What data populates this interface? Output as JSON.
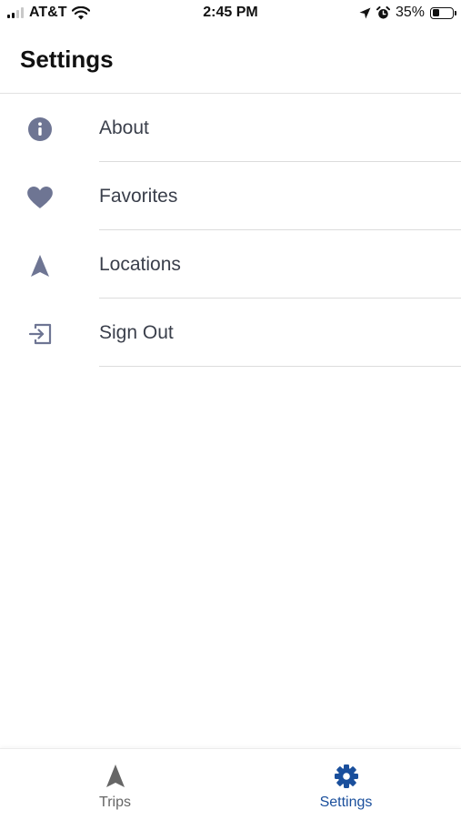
{
  "status_bar": {
    "carrier": "AT&T",
    "time": "2:45 PM",
    "battery_percent": "35%",
    "battery_level": 0.35,
    "icons": [
      "signal-icon",
      "wifi-icon",
      "location-arrow-icon",
      "alarm-icon",
      "battery-icon"
    ]
  },
  "header": {
    "title": "Settings"
  },
  "menu": {
    "items": [
      {
        "label": "About",
        "icon": "info-icon"
      },
      {
        "label": "Favorites",
        "icon": "heart-icon"
      },
      {
        "label": "Locations",
        "icon": "navigation-arrow-icon"
      },
      {
        "label": "Sign Out",
        "icon": "sign-out-icon"
      }
    ]
  },
  "tab_bar": {
    "tabs": [
      {
        "label": "Trips",
        "icon": "navigation-arrow-icon",
        "active": false
      },
      {
        "label": "Settings",
        "icon": "gear-icon",
        "active": true
      }
    ]
  },
  "colors": {
    "menu_icon": "#6e7593",
    "menu_label": "#3a3f4b",
    "tab_active": "#1a4f9c",
    "tab_inactive": "#666666"
  }
}
